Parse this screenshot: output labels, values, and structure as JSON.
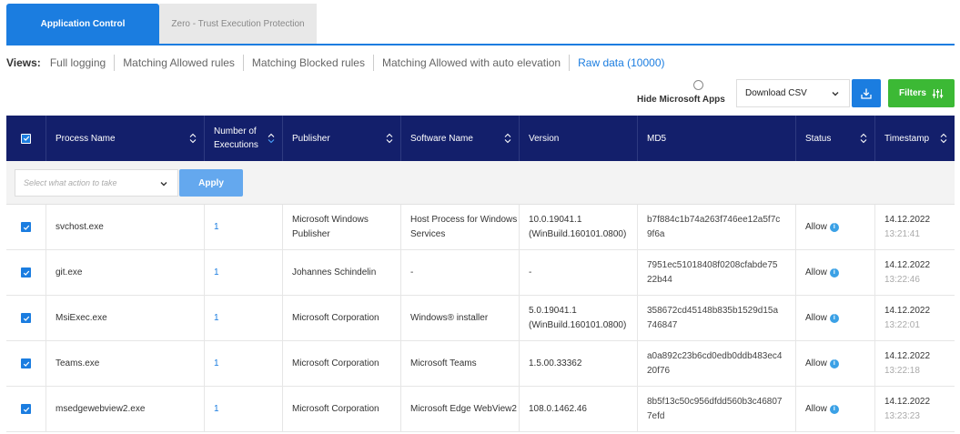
{
  "tabs": [
    {
      "label": "Application Control",
      "active": true
    },
    {
      "label": "Zero - Trust Execution Protection",
      "active": false
    }
  ],
  "views": {
    "label": "Views:",
    "items": [
      {
        "label": "Full logging",
        "active": false
      },
      {
        "label": "Matching Allowed rules",
        "active": false
      },
      {
        "label": "Matching Blocked rules",
        "active": false
      },
      {
        "label": "Matching Allowed with auto elevation",
        "active": false
      },
      {
        "label": "Raw data (10000)",
        "active": true
      }
    ]
  },
  "toolbar": {
    "hide_microsoft_label": "Hide Microsoft Apps",
    "download_value": "Download CSV",
    "filters_label": "Filters"
  },
  "table": {
    "headers": {
      "process": "Process Name",
      "executions_line1": "Number of",
      "executions_line2": "Executions",
      "publisher": "Publisher",
      "software": "Software Name",
      "version": "Version",
      "md5": "MD5",
      "status": "Status",
      "timestamp": "Timestamp"
    },
    "action_placeholder": "Select what action to take",
    "apply_label": "Apply",
    "rows": [
      {
        "process": "svchost.exe",
        "executions": "1",
        "publisher": "Microsoft Windows Publisher",
        "software": "Host Process for Windows Services",
        "version": "10.0.19041.1 (WinBuild.160101.0800)",
        "md5": "b7f884c1b74a263f746ee12a5f7c9f6a",
        "status": "Allow",
        "date": "14.12.2022",
        "time": "13:21:41"
      },
      {
        "process": "git.exe",
        "executions": "1",
        "publisher": "Johannes Schindelin",
        "software": "-",
        "version": "-",
        "md5": "7951ec51018408f0208cfabde7522b44",
        "status": "Allow",
        "date": "14.12.2022",
        "time": "13:22:46"
      },
      {
        "process": "MsiExec.exe",
        "executions": "1",
        "publisher": "Microsoft Corporation",
        "software": "Windows® installer",
        "version": "5.0.19041.1 (WinBuild.160101.0800)",
        "md5": "358672cd45148b835b1529d15a746847",
        "status": "Allow",
        "date": "14.12.2022",
        "time": "13:22:01"
      },
      {
        "process": "Teams.exe",
        "executions": "1",
        "publisher": "Microsoft Corporation",
        "software": "Microsoft Teams",
        "version": "1.5.00.33362",
        "md5": "a0a892c23b6cd0edb0ddb483ec420f76",
        "status": "Allow",
        "date": "14.12.2022",
        "time": "13:22:18"
      },
      {
        "process": "msedgewebview2.exe",
        "executions": "1",
        "publisher": "Microsoft Corporation",
        "software": "Microsoft Edge WebView2",
        "version": "108.0.1462.46",
        "md5": "8b5f13c50c956dfdd560b3c468077efd",
        "status": "Allow",
        "date": "14.12.2022",
        "time": "13:23:23"
      }
    ]
  },
  "colors": {
    "accent": "#1b7de0",
    "header_bg": "#131f6b",
    "filters_green": "#3cb935"
  }
}
